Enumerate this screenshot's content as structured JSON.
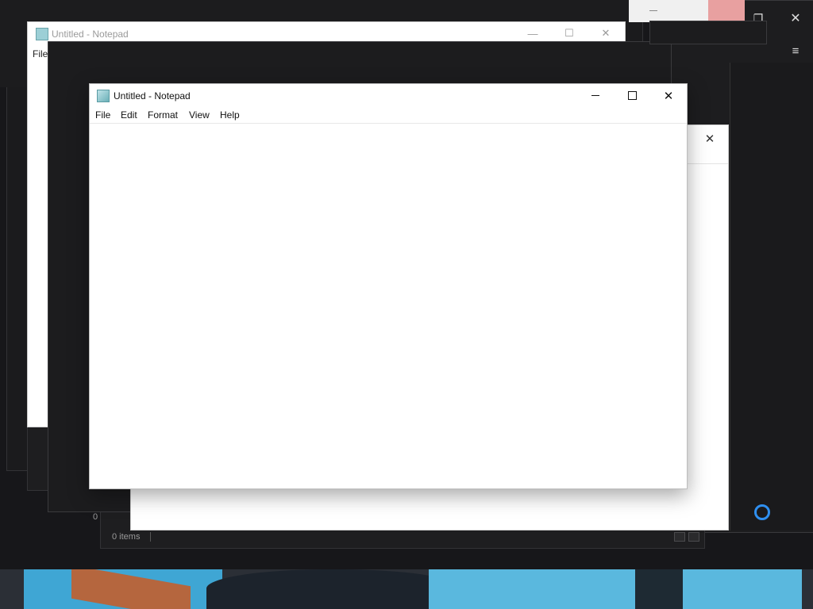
{
  "windows": {
    "notepad_front": {
      "title": "Untitled - Notepad",
      "menu": [
        "File",
        "Edit",
        "Format",
        "View",
        "Help"
      ]
    },
    "notepad_back": {
      "title": "Untitled - Notepad",
      "menu_first": "File"
    },
    "explorer": {
      "status_items": "0 items",
      "status_items_back": "0"
    }
  },
  "icons": {
    "minimize": "minimize-icon",
    "maximize": "maximize-icon",
    "close": "close-icon",
    "restore": "restore-icon",
    "hamburger": "menu-icon",
    "cortana": "cortana-ring-icon"
  },
  "colors": {
    "background": "#17171a",
    "accent_blue": "#2f8ff0"
  }
}
